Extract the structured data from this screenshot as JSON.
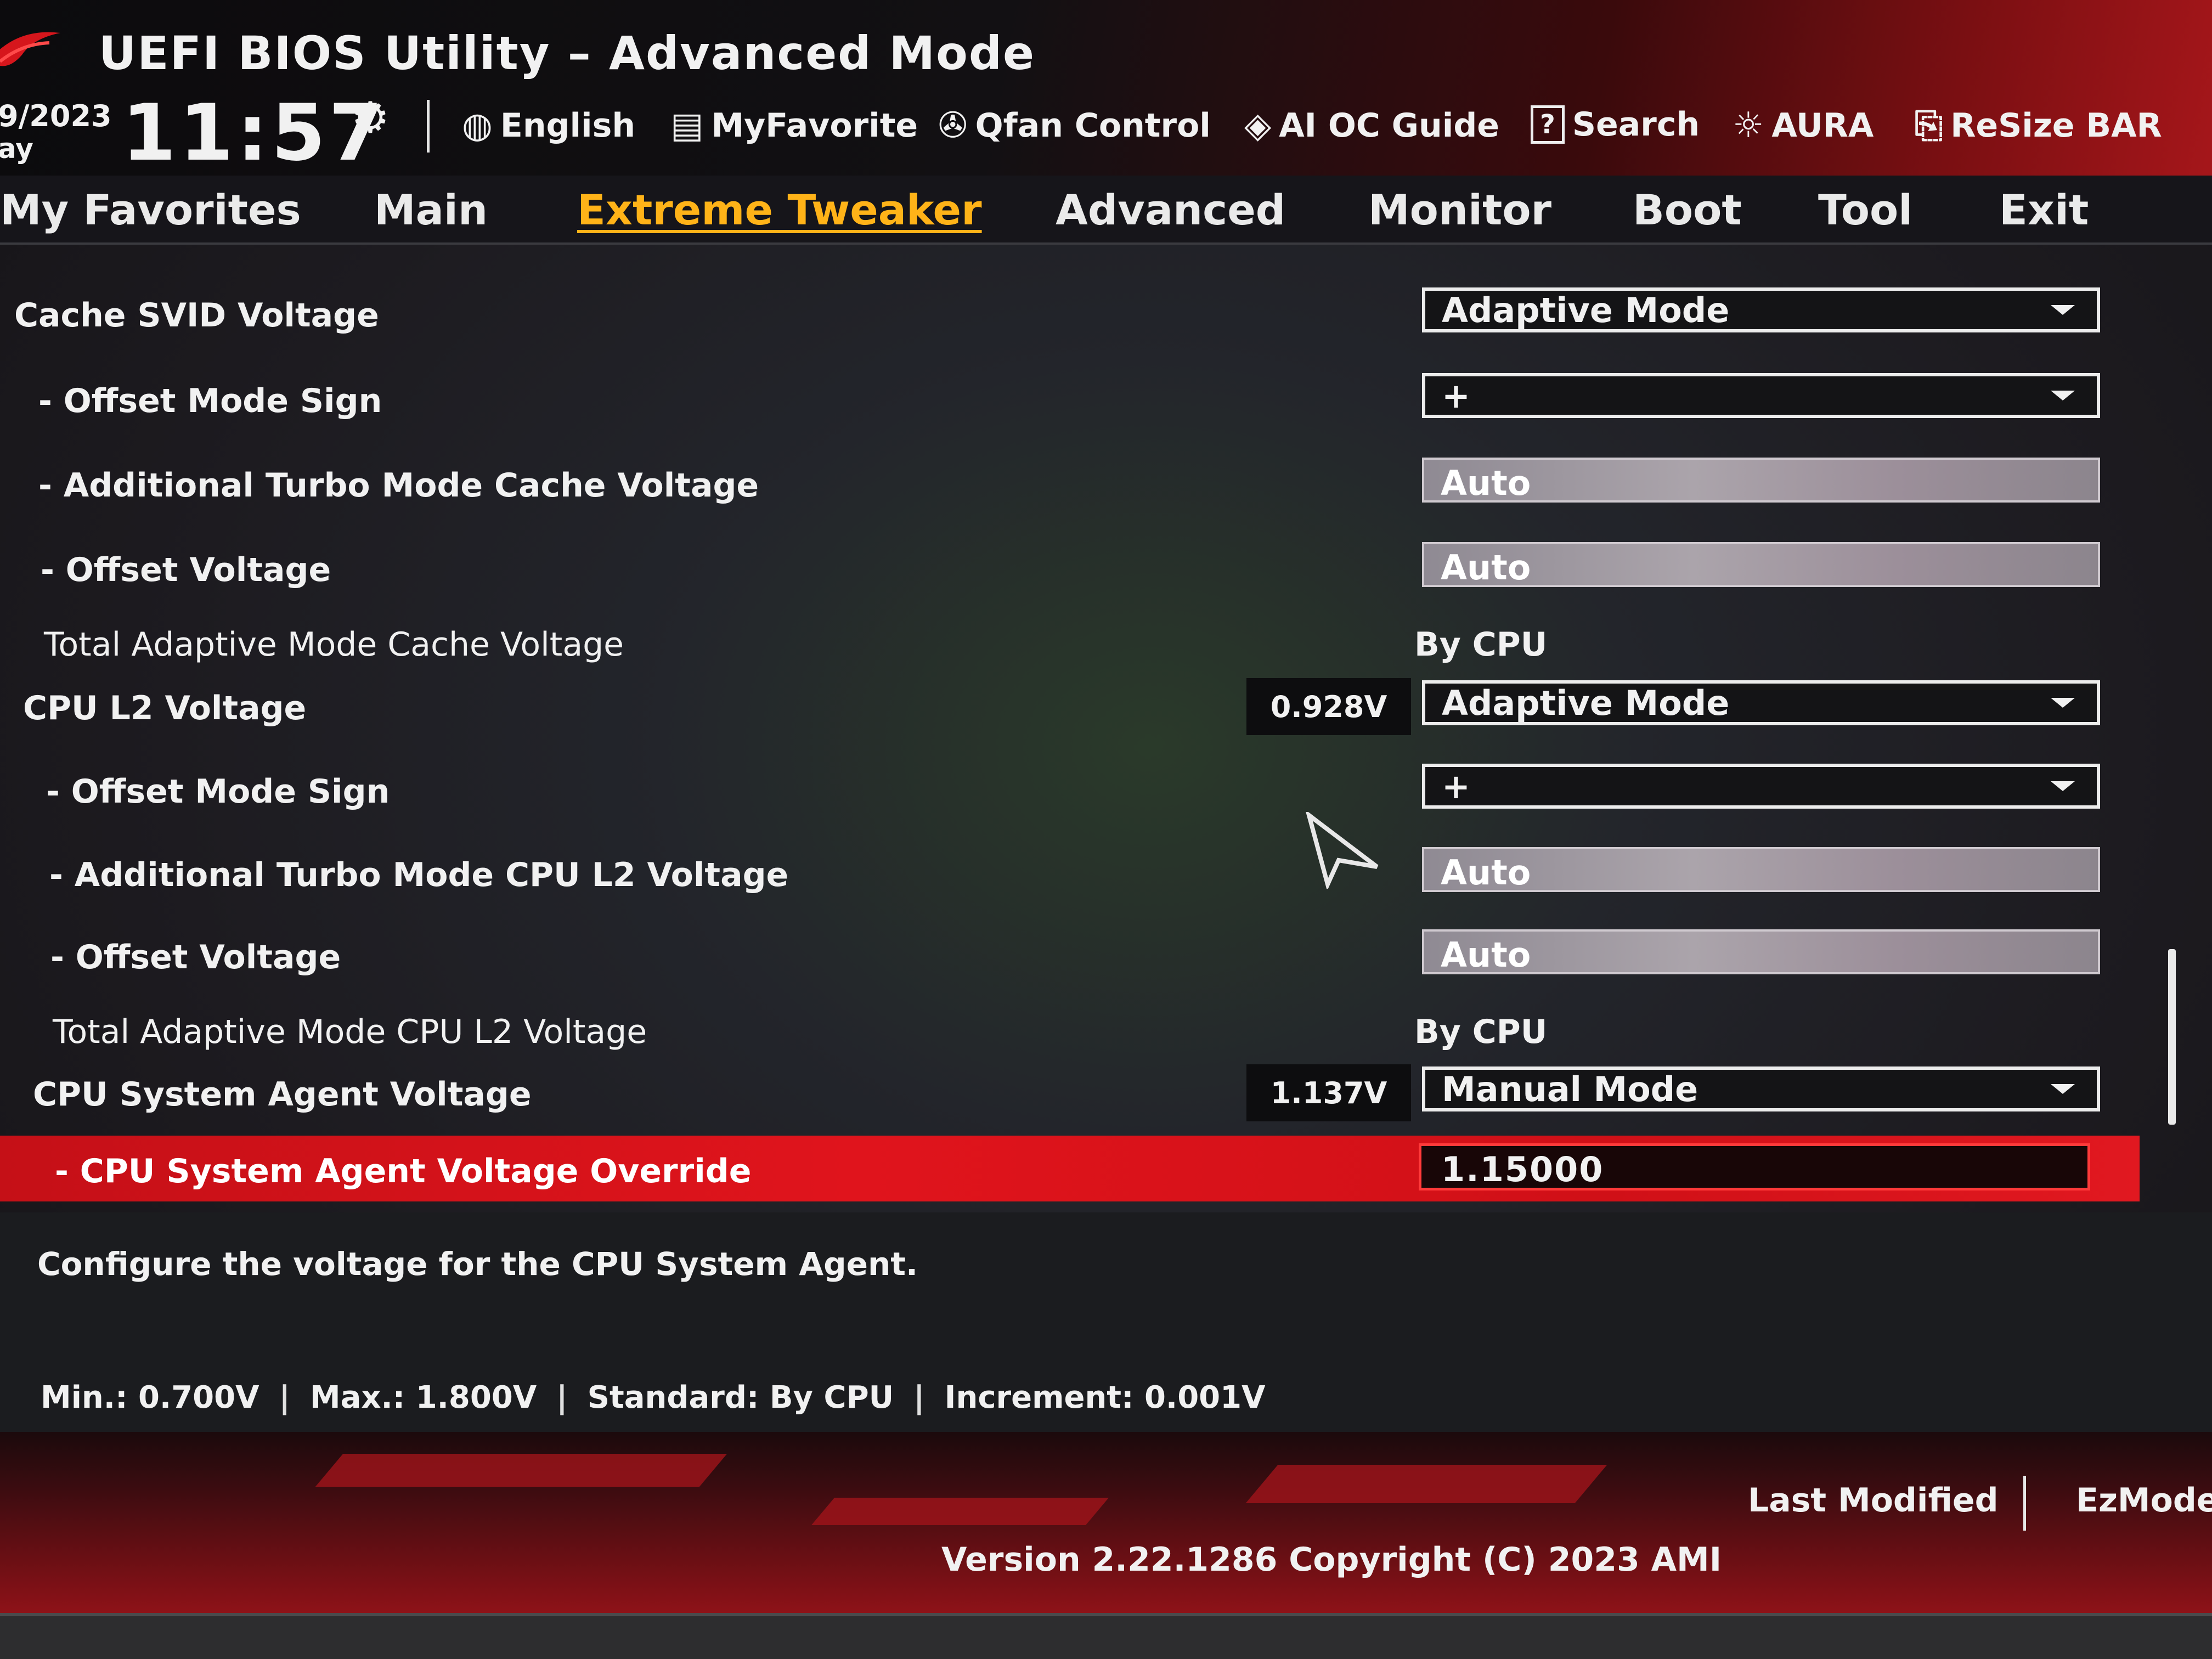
{
  "header": {
    "title": "UEFI BIOS Utility – Advanced Mode",
    "date": "9/2023",
    "day": "ay",
    "time": "11:57",
    "toolbar": [
      {
        "label": "English",
        "icon": "globe-icon",
        "glyph": "🌐"
      },
      {
        "label": "MyFavorite",
        "icon": "favorite-list-icon",
        "glyph": "▤"
      },
      {
        "label": "Qfan Control",
        "icon": "fan-icon",
        "glyph": "✇"
      },
      {
        "label": "AI OC Guide",
        "icon": "ai-chip-icon",
        "glyph": "◈"
      },
      {
        "label": "Search",
        "icon": "search-help-icon",
        "glyph": "?"
      },
      {
        "label": "AURA",
        "icon": "aura-light-icon",
        "glyph": "☼"
      },
      {
        "label": "ReSize BAR",
        "icon": "resize-bar-icon",
        "glyph": "⎘"
      }
    ]
  },
  "nav": {
    "tabs": [
      "My Favorites",
      "Main",
      "Extreme Tweaker",
      "Advanced",
      "Monitor",
      "Boot",
      "Tool",
      "Exit"
    ],
    "active": "Extreme Tweaker"
  },
  "settings": [
    {
      "label": "Cache SVID Voltage",
      "control": "dropdown",
      "value": "Adaptive Mode"
    },
    {
      "label": "- Offset Mode Sign",
      "control": "dropdown",
      "value": "+"
    },
    {
      "label": "- Additional Turbo Mode Cache Voltage",
      "control": "field",
      "value": "Auto"
    },
    {
      "label": "- Offset Voltage",
      "control": "field",
      "value": "Auto"
    },
    {
      "label": "Total Adaptive Mode Cache Voltage",
      "control": "text",
      "value": "By CPU"
    },
    {
      "label": "CPU L2 Voltage",
      "control": "dropdown",
      "value": "Adaptive Mode",
      "reading": "0.928V"
    },
    {
      "label": "- Offset Mode Sign",
      "control": "dropdown",
      "value": "+"
    },
    {
      "label": "- Additional Turbo Mode CPU L2 Voltage",
      "control": "field",
      "value": "Auto"
    },
    {
      "label": "- Offset Voltage",
      "control": "field",
      "value": "Auto"
    },
    {
      "label": "Total Adaptive Mode CPU L2 Voltage",
      "control": "text",
      "value": "By CPU"
    },
    {
      "label": "CPU System Agent Voltage",
      "control": "dropdown",
      "value": "Manual Mode",
      "reading": "1.137V"
    },
    {
      "label": "- CPU System Agent Voltage Override",
      "control": "input",
      "value": "1.15000",
      "selected": true
    }
  ],
  "help": {
    "description": "Configure the voltage for the CPU System Agent.",
    "min": "Min.: 0.700V",
    "max": "Max.: 1.800V",
    "standard": "Standard: By CPU",
    "increment": "Increment: 0.001V",
    "separator": "|"
  },
  "footer": {
    "last_modified": "Last Modified",
    "separator": "|",
    "ezmode": "EzMode",
    "version": "Version 2.22.1286 Copyright (C) 2023 AMI"
  },
  "colors": {
    "accent_tab": "#ffb318",
    "selected_row": "#d01017",
    "brand_red": "#a5161a"
  }
}
